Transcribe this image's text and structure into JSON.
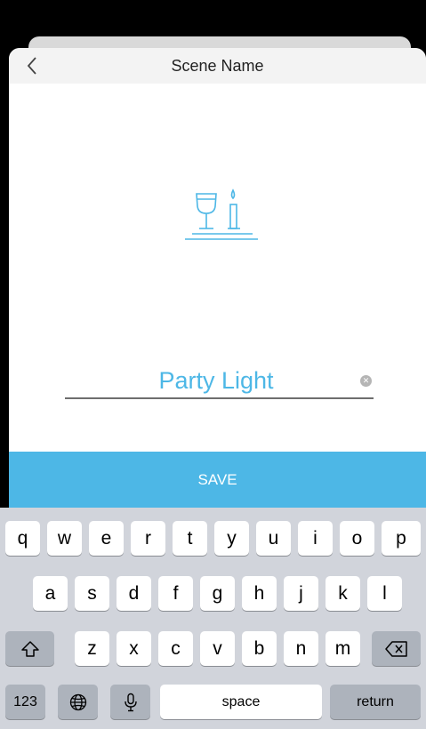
{
  "header": {
    "title": "Scene Name"
  },
  "icons": {
    "back": "chevron-left-icon",
    "scene": "dinner-candle-icon",
    "clear": "clear-circle-icon"
  },
  "scene": {
    "name_value": "Party Light"
  },
  "save_label": "SAVE",
  "keyboard": {
    "row1": [
      "q",
      "w",
      "e",
      "r",
      "t",
      "y",
      "u",
      "i",
      "o",
      "p"
    ],
    "row2": [
      "a",
      "s",
      "d",
      "f",
      "g",
      "h",
      "j",
      "k",
      "l"
    ],
    "row3": [
      "z",
      "x",
      "c",
      "v",
      "b",
      "n",
      "m"
    ],
    "numbers_label": "123",
    "space_label": "space",
    "return_label": "return"
  },
  "colors": {
    "accent": "#4db7e6",
    "keyboard_bg": "#d1d4db"
  }
}
